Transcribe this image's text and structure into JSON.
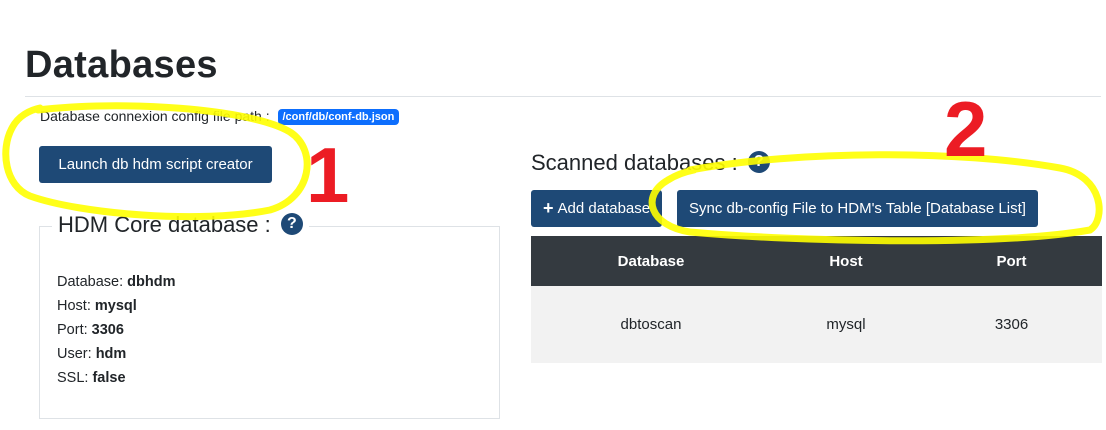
{
  "page": {
    "title": "Databases",
    "config_label": "Database connexion config file path :",
    "config_path": "/conf/db/conf-db.json"
  },
  "buttons": {
    "launch_label": "Launch db hdm script creator",
    "add_label": "Add database",
    "sync_label": "Sync db-config File to HDM's Table [Database List]"
  },
  "core": {
    "title": "HDM Core database :",
    "fields": [
      {
        "label": "Database:",
        "value": "dbhdm"
      },
      {
        "label": "Host:",
        "value": "mysql"
      },
      {
        "label": "Port:",
        "value": "3306"
      },
      {
        "label": "User:",
        "value": "hdm"
      },
      {
        "label": "SSL:",
        "value": "false"
      }
    ]
  },
  "scanned": {
    "title": "Scanned databases :",
    "columns": [
      "Database",
      "Host",
      "Port"
    ],
    "rows": [
      [
        "dbtoscan",
        "mysql",
        "3306"
      ]
    ]
  },
  "annotations": {
    "one": "1",
    "two": "2",
    "highlight_color": "#ffff00",
    "number_color": "#ec1c24"
  },
  "icons": {
    "help": "?",
    "plus": "+"
  },
  "colors": {
    "button": "#1e4976",
    "badge": "#0d6efd",
    "table_header": "#343a40"
  }
}
